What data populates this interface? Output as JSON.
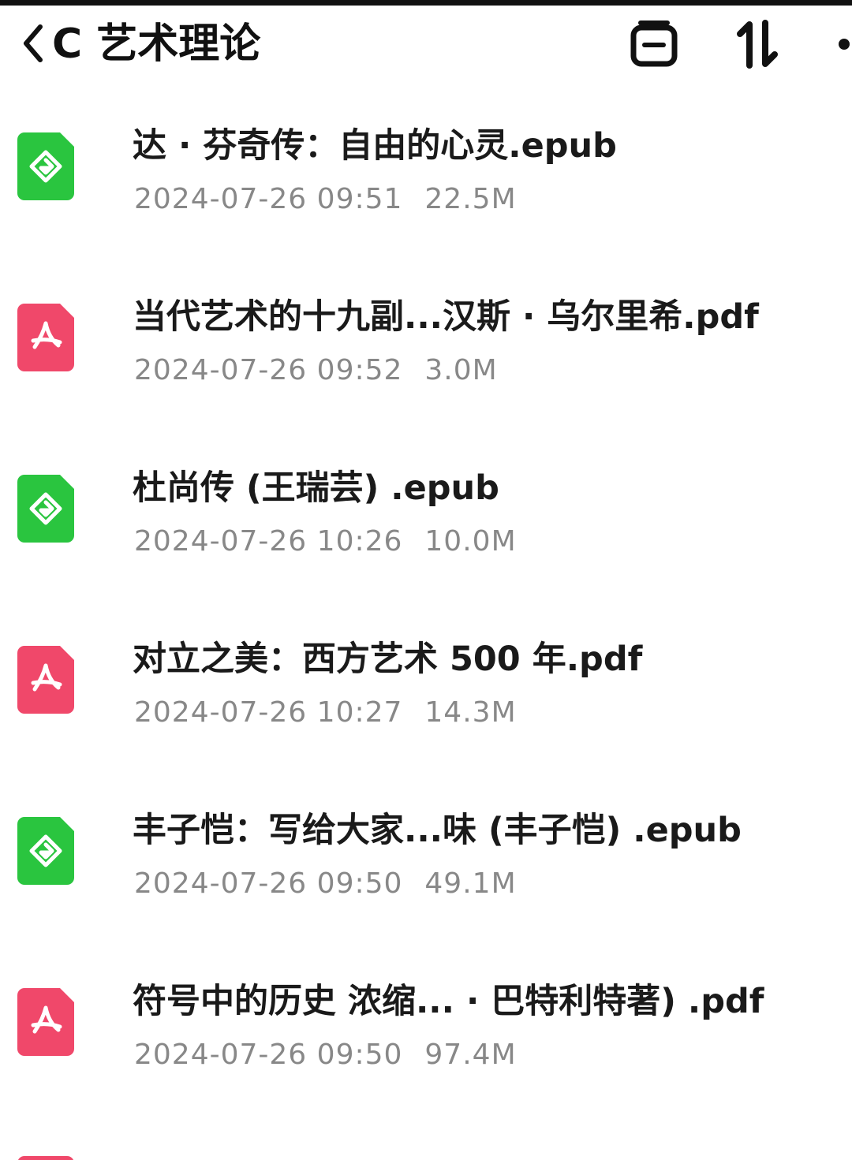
{
  "header": {
    "back_label": "<",
    "title": "C 艺术理论",
    "window_icon": "window-icon",
    "sort_icon": "sort-icon",
    "more_icon": "more-icon"
  },
  "files": [
    {
      "name": "达 · 芬奇传：自由的心灵.epub",
      "date": "2024-07-26 09:51",
      "size": "22.5M",
      "type": "epub",
      "icon": "epub-file-icon"
    },
    {
      "name": "当代艺术的十九副...汉斯 · 乌尔里希.pdf",
      "date": "2024-07-26 09:52",
      "size": "3.0M",
      "type": "pdf",
      "icon": "pdf-file-icon"
    },
    {
      "name": "杜尚传 (王瑞芸) .epub",
      "date": "2024-07-26 10:26",
      "size": "10.0M",
      "type": "epub",
      "icon": "epub-file-icon"
    },
    {
      "name": "对立之美：西方艺术 500 年.pdf",
      "date": "2024-07-26 10:27",
      "size": "14.3M",
      "type": "pdf",
      "icon": "pdf-file-icon"
    },
    {
      "name": "丰子恺：写给大家...味 (丰子恺) .epub",
      "date": "2024-07-26 09:50",
      "size": "49.1M",
      "type": "epub",
      "icon": "epub-file-icon"
    },
    {
      "name": "符号中的历史 浓缩... · 巴特利特著) .pdf",
      "date": "2024-07-26 09:50",
      "size": "97.4M",
      "type": "pdf",
      "icon": "pdf-file-icon"
    }
  ],
  "colors": {
    "epub": "#2ac53f",
    "pdf": "#f0486a",
    "meta_text": "#888888",
    "title_text": "#111111"
  }
}
